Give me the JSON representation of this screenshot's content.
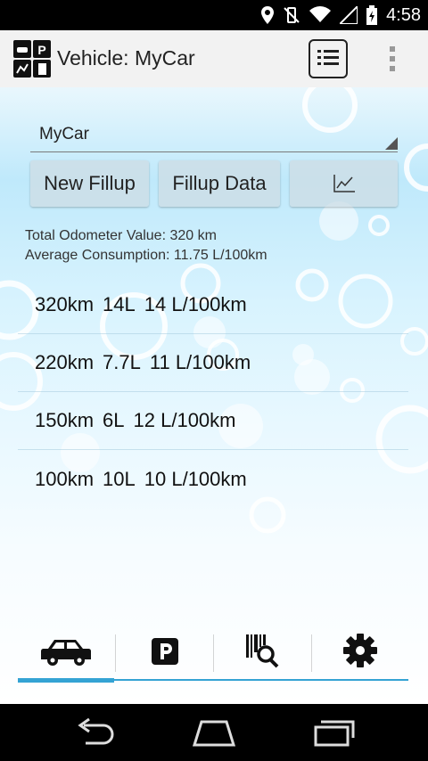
{
  "status_bar": {
    "time": "4:58",
    "icons": [
      "location-icon",
      "vibrate-off-icon",
      "wifi-icon",
      "signal-icon",
      "battery-icon"
    ]
  },
  "action_bar": {
    "title": "Vehicle: MyCar",
    "icons": [
      "app-logo-icon",
      "list-icon",
      "overflow-menu-icon"
    ]
  },
  "vehicle_spinner": {
    "selected": "MyCar"
  },
  "buttons": {
    "new_fillup": "New Fillup",
    "fillup_data": "Fillup Data",
    "chart_icon": "chart-icon"
  },
  "summary": {
    "odometer": "Total Odometer Value: 320 km",
    "consumption": "Average Consumption: 11.75 L/100km"
  },
  "fillups": [
    {
      "distance": "320km",
      "fuel": "14L",
      "consumption": "14 L/100km"
    },
    {
      "distance": "220km",
      "fuel": "7.7L",
      "consumption": "11 L/100km"
    },
    {
      "distance": "150km",
      "fuel": "6L",
      "consumption": "12 L/100km"
    },
    {
      "distance": "100km",
      "fuel": "10L",
      "consumption": "10 L/100km"
    }
  ],
  "bottom_tabs": {
    "items": [
      "car-icon",
      "parking-icon",
      "barcode-search-icon",
      "settings-icon"
    ],
    "selected": 0
  },
  "nav_bar": {
    "icons": [
      "back-icon",
      "home-icon",
      "recents-icon"
    ]
  },
  "colors": {
    "accent": "#34a3d4",
    "action_bar": "#f2f2f2",
    "button_bg": "#cddce4"
  }
}
